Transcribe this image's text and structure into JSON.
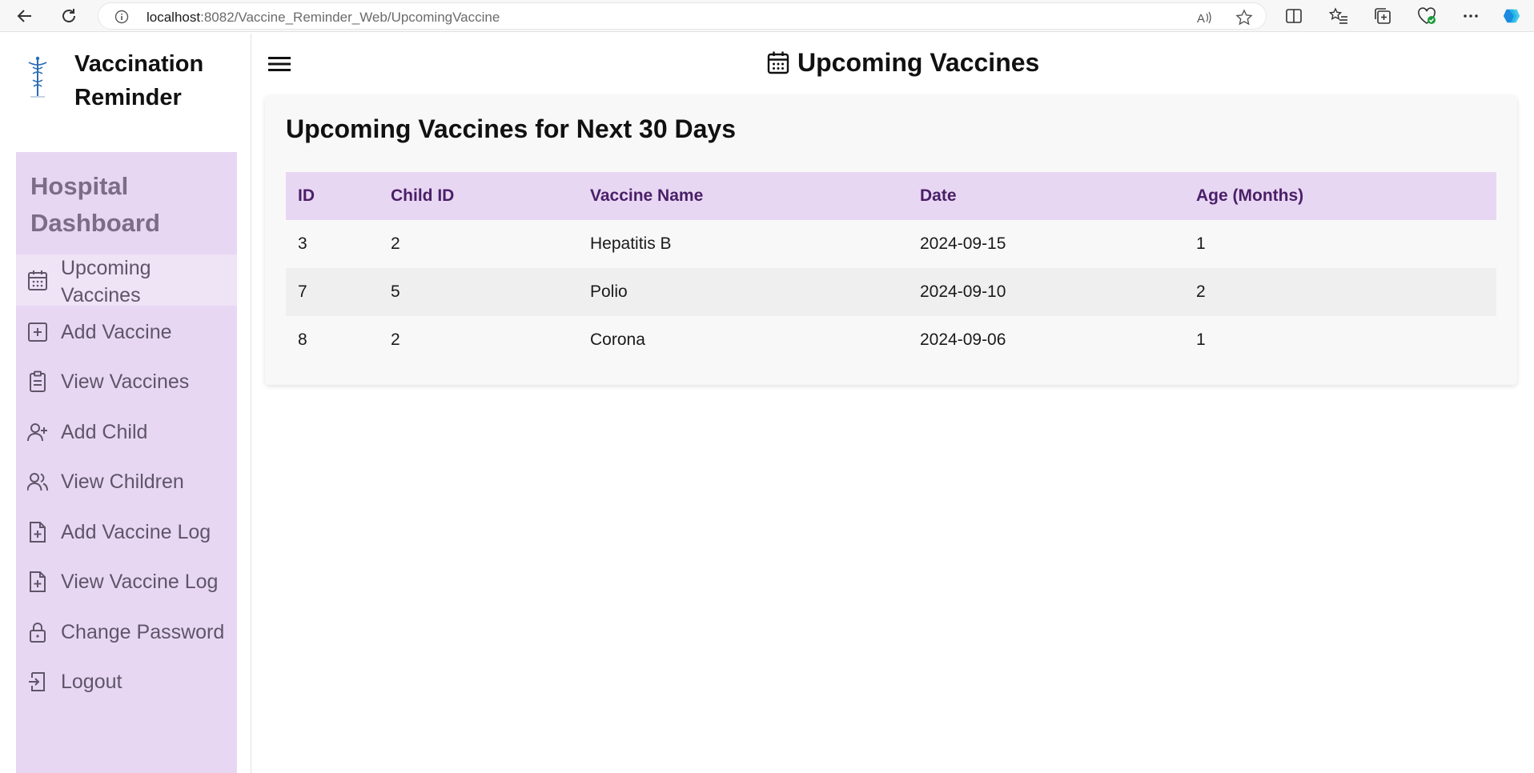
{
  "browser": {
    "url_host": "localhost",
    "url_rest": ":8082/Vaccine_Reminder_Web/UpcomingVaccine"
  },
  "brand": {
    "name": "Vaccination Reminder"
  },
  "sidebar": {
    "heading": "Hospital Dashboard",
    "items": [
      {
        "label": "Upcoming Vaccines",
        "icon": "calendar-icon",
        "active": true
      },
      {
        "label": "Add Vaccine",
        "icon": "plus-square-icon"
      },
      {
        "label": "View Vaccines",
        "icon": "clipboard-icon"
      },
      {
        "label": "Add Child",
        "icon": "user-plus-icon"
      },
      {
        "label": "View Children",
        "icon": "users-icon"
      },
      {
        "label": "Add Vaccine Log",
        "icon": "file-plus-icon"
      },
      {
        "label": "View Vaccine Log",
        "icon": "file-plus-icon"
      },
      {
        "label": "Change Password",
        "icon": "lock-icon"
      },
      {
        "label": "Logout",
        "icon": "logout-icon"
      }
    ]
  },
  "header": {
    "title": "Upcoming Vaccines"
  },
  "card": {
    "title": "Upcoming Vaccines for Next 30 Days",
    "columns": [
      "ID",
      "Child ID",
      "Vaccine Name",
      "Date",
      "Age (Months)"
    ],
    "rows": [
      [
        "3",
        "2",
        "Hepatitis B",
        "2024-09-15",
        "1"
      ],
      [
        "7",
        "5",
        "Polio",
        "2024-09-10",
        "2"
      ],
      [
        "8",
        "2",
        "Corona",
        "2024-09-06",
        "1"
      ]
    ]
  },
  "colors": {
    "sidebar_bg": "#e8d7f3",
    "header_text": "#4a1f67",
    "menu_text": "#5f5568"
  }
}
